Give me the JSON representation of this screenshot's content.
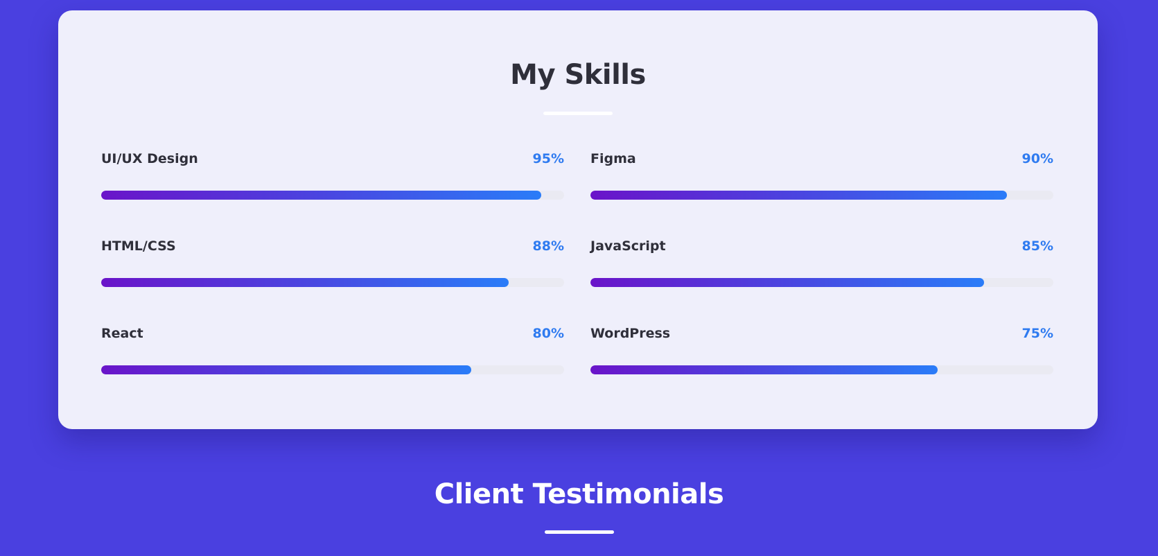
{
  "skills_section": {
    "title": "My Skills",
    "skills": [
      {
        "name": "UI/UX Design",
        "percent_label": "95%",
        "level": 95
      },
      {
        "name": "Figma",
        "percent_label": "90%",
        "level": 90
      },
      {
        "name": "HTML/CSS",
        "percent_label": "88%",
        "level": 88
      },
      {
        "name": "JavaScript",
        "percent_label": "85%",
        "level": 85
      },
      {
        "name": "React",
        "percent_label": "80%",
        "level": 80
      },
      {
        "name": "WordPress",
        "percent_label": "75%",
        "level": 75
      }
    ]
  },
  "testimonials_section": {
    "title": "Client Testimonials"
  },
  "colors": {
    "page_background": "#4a40e0",
    "card_background": "#efeffb",
    "accent_blue": "#2f7bf0",
    "gradient_start": "#6a14c9",
    "gradient_end": "#2a7cf8"
  }
}
